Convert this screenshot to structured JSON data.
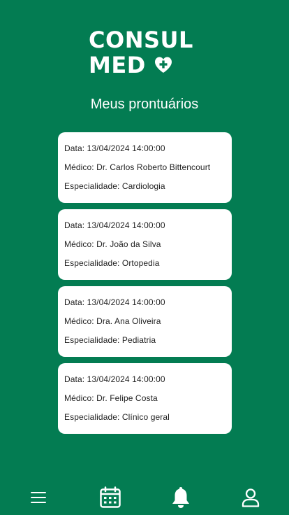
{
  "logo": {
    "line1": "CONSUL",
    "line2": "MED"
  },
  "page": {
    "title": "Meus prontuários"
  },
  "records": [
    {
      "date": "Data: 13/04/2024 14:00:00",
      "doctor": "Médico: Dr. Carlos Roberto Bittencourt",
      "specialty": "Especialidade: Cardiologia"
    },
    {
      "date": "Data: 13/04/2024 14:00:00",
      "doctor": "Médico: Dr. João da Silva",
      "specialty": "Especialidade: Ortopedia"
    },
    {
      "date": "Data: 13/04/2024 14:00:00",
      "doctor": "Médico: Dra. Ana Oliveira",
      "specialty": "Especialidade: Pediatria"
    },
    {
      "date": "Data: 13/04/2024 14:00:00",
      "doctor": "Médico: Dr. Felipe Costa",
      "specialty": "Especialidade: Clínico geral"
    }
  ],
  "nav": [
    {
      "name": "menu",
      "icon": "hamburger-menu-icon"
    },
    {
      "name": "calendar",
      "icon": "calendar-icon"
    },
    {
      "name": "notifications",
      "icon": "bell-icon"
    },
    {
      "name": "profile",
      "icon": "user-icon"
    }
  ],
  "colors": {
    "background": "#037c52",
    "card": "#ffffff",
    "text_on_card": "#1f1f1f",
    "text_on_background": "#ffffff"
  }
}
